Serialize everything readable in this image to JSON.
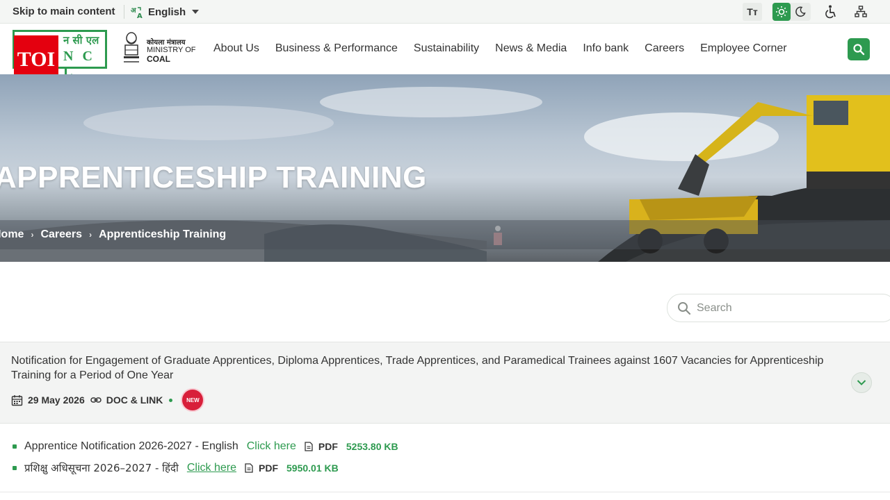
{
  "utility_bar": {
    "skip_link": "Skip to main content",
    "language": "English",
    "text_size_label": "Tт"
  },
  "brand": {
    "logo_hindi": "न सी एल",
    "logo_english": "N C L",
    "overlay_badge": "TOI",
    "ministry_hindi": "कोयला मंत्रालय",
    "ministry_line1": "MINISTRY OF",
    "ministry_line2": "COAL"
  },
  "nav": {
    "items": [
      "About Us",
      "Business & Performance",
      "Sustainability",
      "News & Media",
      "Info bank",
      "Careers",
      "Employee Corner"
    ]
  },
  "banner": {
    "title": "APPRENTICESHIP TRAINING",
    "breadcrumbs": [
      "Home",
      "Careers",
      "Apprenticeship Training"
    ]
  },
  "search": {
    "placeholder": "Search"
  },
  "notification": {
    "title": "Notification for Engagement of Graduate Apprentices, Diploma Apprentices, Trade Apprentices, and Paramedical Trainees against 1607 Vacancies for Apprenticeship Training for a Period of One Year",
    "date": "29 May 2026",
    "type": "DOC & LINK",
    "badge": "NEW"
  },
  "documents": [
    {
      "name": "Apprentice Notification 2026-2027 - English",
      "link_text": "Click here",
      "file_type": "PDF",
      "file_size": "5253.80 KB"
    },
    {
      "name": "प्रशिक्षु अधिसूचना 2026–2027 - हिंदी",
      "link_text": "Click here",
      "file_type": "PDF",
      "file_size": "5950.01 KB"
    }
  ],
  "colors": {
    "brand_green": "#2d9a4f",
    "badge_red": "#d81f3a",
    "toi_red": "#e4000f"
  }
}
